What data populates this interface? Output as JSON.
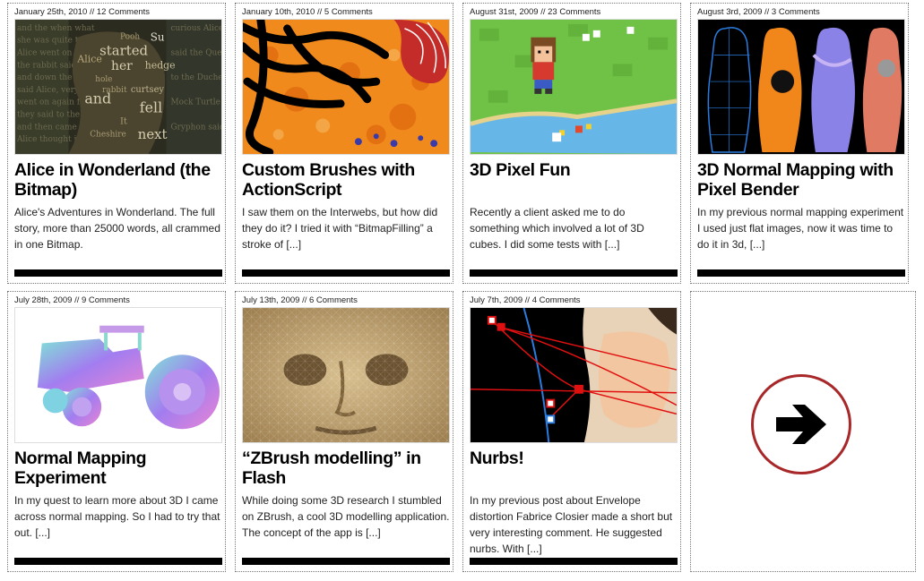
{
  "posts": [
    {
      "meta": "January 25th, 2010 // 12 Comments",
      "title": "Alice in Wonderland (the Bitmap)",
      "excerpt": "Alice's Adventures in Wonderland. The full story, more than 25000 words, all crammed in one Bitmap.",
      "thumb_words": [
        "Alice",
        "started",
        "her",
        "fell",
        "and",
        "next",
        "Su",
        "curtsey",
        "hedge",
        "It",
        "Cheshire",
        "Pooh",
        "hole",
        "rabbit"
      ]
    },
    {
      "meta": "January 10th, 2010 // 5 Comments",
      "title": "Custom Brushes with ActionScript",
      "excerpt": "I saw them on the Interwebs, but how did they do it? I tried it with “BitmapFilling” a stroke of [...]"
    },
    {
      "meta": "August 31st, 2009 // 23 Comments",
      "title": "3D Pixel Fun",
      "excerpt": "Recently a client asked me to do something which involved a lot of 3D cubes. I did some tests with [...]"
    },
    {
      "meta": "August 3rd, 2009 // 3 Comments",
      "title": "3D Normal Mapping with Pixel Bender",
      "excerpt": "In my previous normal mapping experiment I used just flat images, now it was time to do it in 3d, [...]"
    },
    {
      "meta": "July 28th, 2009 // 9 Comments",
      "title": "Normal Mapping Experiment",
      "excerpt": "In my quest to learn more about 3D I came across normal mapping. So I had to try that out. [...]"
    },
    {
      "meta": "July 13th, 2009 // 6 Comments",
      "title": "“ZBrush modelling” in Flash",
      "excerpt": "While doing some 3D research I stumbled on ZBrush, a cool 3D modelling application. The concept of the app is [...]"
    },
    {
      "meta": "July 7th, 2009 // 4 Comments",
      "title": "Nurbs!",
      "excerpt": "In my previous post about Envelope distortion Fabrice Closier made a short but very interesting comment. He suggested nurbs. With [...]"
    }
  ],
  "icons": {
    "next": "arrow-right-icon"
  },
  "colors": {
    "accent": "#a8282a",
    "bar": "#000000",
    "orange": "#f08a1c",
    "pixel_green": "#6fc246",
    "pixel_water": "#67b6e8"
  }
}
